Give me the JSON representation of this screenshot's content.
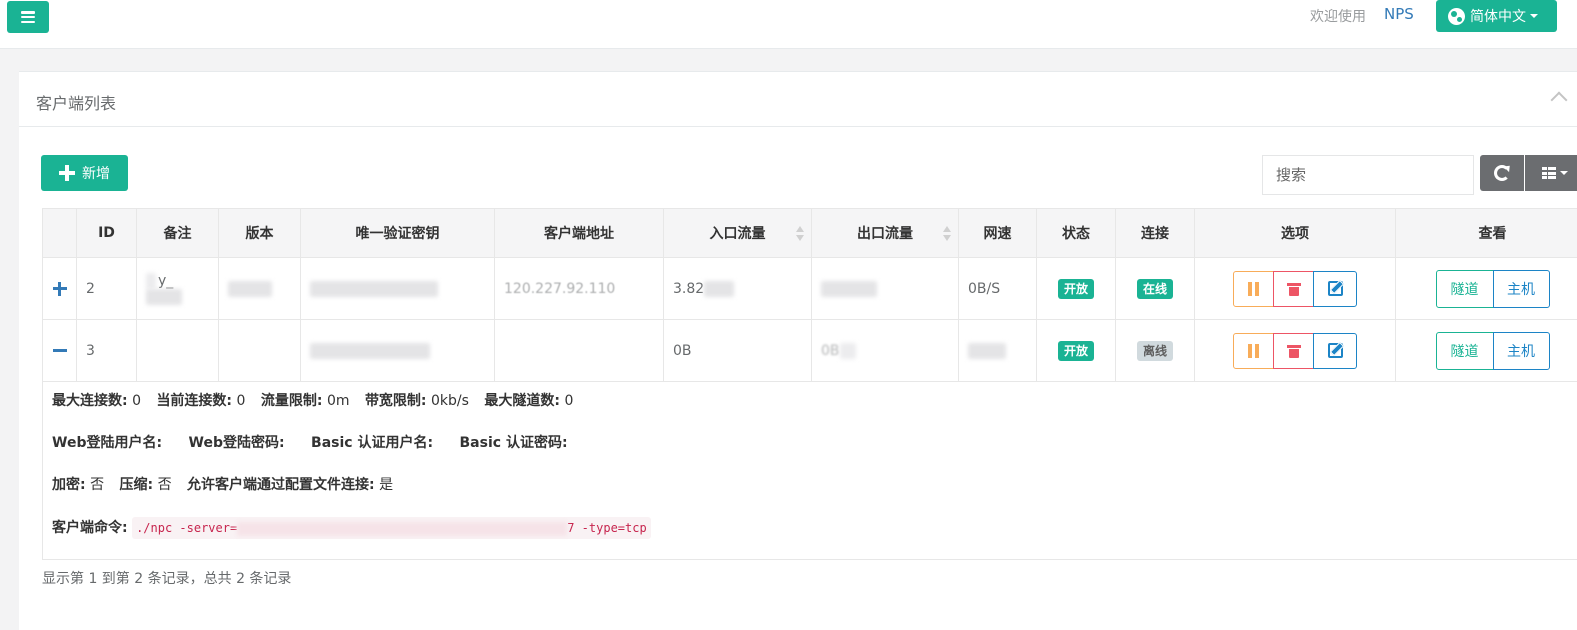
{
  "topbar": {
    "welcome": "欢迎使用",
    "brand": "NPS",
    "language": "简体中文"
  },
  "panel": {
    "title": "客户端列表"
  },
  "toolbar": {
    "add_label": "新增",
    "search_placeholder": "搜索"
  },
  "table": {
    "headers": [
      "",
      "ID",
      "备注",
      "版本",
      "唯一验证密钥",
      "客户端地址",
      "入口流量",
      "出口流量",
      "网速",
      "状态",
      "连接",
      "选项",
      "查看"
    ],
    "rows": [
      {
        "id": "2",
        "remark": "y_",
        "address": "120.227.92.110",
        "inflow": "3.82",
        "speed": "0B/S",
        "status": "开放",
        "connection": "在线"
      },
      {
        "id": "3",
        "inflow": "0B",
        "outflow": "0B",
        "status": "开放",
        "connection": "离线"
      }
    ],
    "view_buttons": {
      "tunnel": "隧道",
      "host": "主机"
    }
  },
  "detail": {
    "max_conn_label": "最大连接数:",
    "max_conn": "0",
    "cur_conn_label": "当前连接数:",
    "cur_conn": "0",
    "flow_limit_label": "流量限制:",
    "flow_limit": "0m",
    "rate_limit_label": "带宽限制:",
    "rate_limit": "0kb/s",
    "max_tunnel_label": "最大隧道数:",
    "max_tunnel": "0",
    "web_user_label": "Web登陆用户名:",
    "web_pass_label": "Web登陆密码:",
    "basic_user_label": "Basic 认证用户名:",
    "basic_pass_label": "Basic 认证密码:",
    "crypt_label": "加密:",
    "crypt": "否",
    "compress_label": "压缩:",
    "compress": "否",
    "config_conn_label": "允许客户端通过配置文件连接:",
    "config_conn": "是",
    "cmd_label": "客户端命令:",
    "cmd_prefix": "./npc -server=",
    "cmd_suffix": "7 -type=tcp"
  },
  "footer": {
    "summary": "显示第 1 到第 2 条记录，总共 2 条记录"
  },
  "colors": {
    "primary": "#1ab394",
    "info": "#1c84c6",
    "warning": "#f8ac59",
    "danger": "#ed5565",
    "link": "#337ab7"
  },
  "icons": {
    "menu": "menu-icon",
    "language": "globe-icon",
    "add": "plus-icon",
    "refresh": "refresh-icon",
    "columns": "grid-icon",
    "expand": "plus-icon",
    "collapse": "minus-icon",
    "pause": "pause-icon",
    "delete": "trash-icon",
    "edit": "edit-icon"
  }
}
